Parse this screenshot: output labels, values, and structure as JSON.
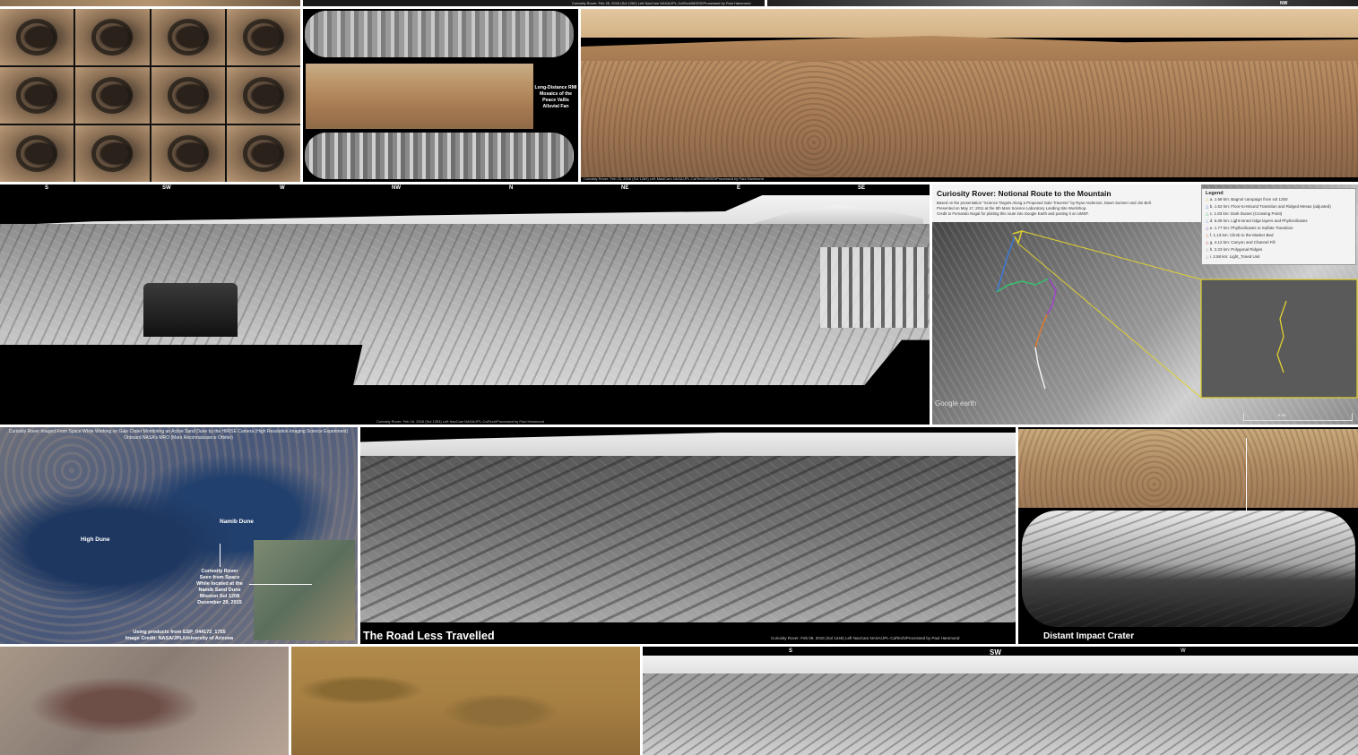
{
  "top_strip": {
    "caption_center": "Curiosity Rover: Feb 25, 2016 (Sol 1262) Left NavCam NASA/JPL-CalTech/MSSS/Processed by Paul Hammond",
    "compass_right": "NW"
  },
  "tile_rmi": {
    "title": "Long-Distance RMI Mosaics of the Peace Vallis Alluvial Fan"
  },
  "tile_mastcam_pano": {
    "caption": "Curiosity Rover: Feb 23, 2016 (Sol 1260) Left MastCam NASA/JPL-CalTech/MSSS/Processed by Paul Hammond"
  },
  "tile_navcam_bw": {
    "compass": [
      "S",
      "SW",
      "W",
      "NW",
      "N",
      "NE",
      "E",
      "SE"
    ],
    "caption": "Curiosity Rover: Feb 16, 2016 (Sol 1253) Left NavCam NASA/JPL-CalTech/Processed by Paul Hammond"
  },
  "tile_route_map": {
    "title": "Curiosity Rover: Notional Route to the Mountain",
    "desc": [
      "Based on the presentation \"Science Targets Along a Proposed Gale Traverse\" by Ryan Anderson, Dawn Sumner and Jim Bell.",
      "Presented on May 17, 2011 at the 5th Mars Science Laboratory Landing Site Workshop.",
      "Credit to Fernando Nogal for plotting this route into Google Earth and posting it on UMSF."
    ],
    "legend_title": "Legend",
    "legend": [
      {
        "text": "a. 1.58 km: Bagnol campaign from sol 1250",
        "color": "#d8c030"
      },
      {
        "text": "b. 1.52 km: Floor-to-Mound Transition and Ridged Mesas (adjusted)",
        "color": "#3070d0"
      },
      {
        "text": "c. 1.83 km: Dark Dunes (Crossing Point)",
        "color": "#30b060"
      },
      {
        "text": "d. 5.06 km: Light-toned ridge layers and Phyllosilicates",
        "color": "#6a9fd0"
      },
      {
        "text": "e. 1.77 km: Phyllosilicates to Sulfate Transition",
        "color": "#9040c0"
      },
      {
        "text": "f. 1.13 km: Climb to the Marker Bed",
        "color": "#e07030"
      },
      {
        "text": "g. 4.12 km: Canyon and Channel Fill",
        "color": "#c04040"
      },
      {
        "text": "h. 2.23 km: Polygonal Ridges",
        "color": "#e0e0e0"
      },
      {
        "text": "i. 2.58 km: Light_Toned Unit",
        "color": "#c0c0c0"
      }
    ],
    "watermark": "Google earth",
    "scale": "6 mi"
  },
  "tile_hirise": {
    "title": "Curiosity Rover Imaged From Space While Working on Gale Crater Monitoring an Active Sand Dune by the HiRISE Camera (High Resolution Imaging Science Experiment) Onboard NASA's MRO (Mars Reconnaissance Orbiter)",
    "label_high_dune": "High Dune",
    "label_namib_dune": "Namib Dune",
    "rover_note": [
      "Curiosity Rover",
      "Seen from Space",
      "While located at the",
      "Namib Sand Dune",
      "Mission Sol 1208",
      "December 29, 2015"
    ],
    "credit": [
      "Using products from ESP_044172_1755",
      "Image Credit: NASA/JPL/University of Arizona"
    ]
  },
  "tile_road": {
    "title": "The Road Less Travelled",
    "caption": "Curiosity Rover: Feb 09, 2016 (Sol 1246) Left NavCam NASA/JPL-CalTech/Processed by Paul Hammond"
  },
  "tile_crater": {
    "title": "Distant Impact Crater"
  },
  "tile_bottom_pano": {
    "compass": [
      "S",
      "SW",
      "W"
    ]
  },
  "colors": {
    "mars_tan": "#b8926a",
    "mars_sky": "#c9a77c",
    "bw_sky": "#e6e6e6",
    "route_yellow": "#e0d030"
  }
}
